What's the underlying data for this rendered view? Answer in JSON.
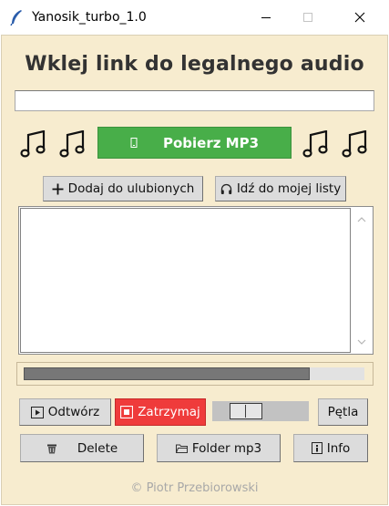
{
  "window": {
    "title": "Yanosik_turbo_1.0"
  },
  "header": {
    "heading": "Wklej link do legalnego audio"
  },
  "link_input": {
    "value": ""
  },
  "download": {
    "label": "Pobierz MP3",
    "color": "#48ae49"
  },
  "actions": {
    "add_favorite": "Dodaj do ulubionych",
    "go_to_list": "Idź do mojej listy"
  },
  "download_progress": 0.84,
  "player": {
    "play": "Odtwórz",
    "stop": "Zatrzymaj",
    "stop_color": "#ef3b3b",
    "loop": "Pętla",
    "volume": 0.27
  },
  "bottom": {
    "delete": "Delete",
    "folder": "Folder mp3",
    "info": "Info"
  },
  "footer": {
    "credit": "© Piotr Przebiorowski"
  },
  "icons": [
    "feather-icon",
    "music-note-icon",
    "minimize-icon",
    "maximize-icon",
    "close-icon",
    "plus-icon",
    "headphones-icon",
    "play-icon",
    "stop-icon",
    "trash-icon",
    "folder-icon",
    "info-icon"
  ]
}
